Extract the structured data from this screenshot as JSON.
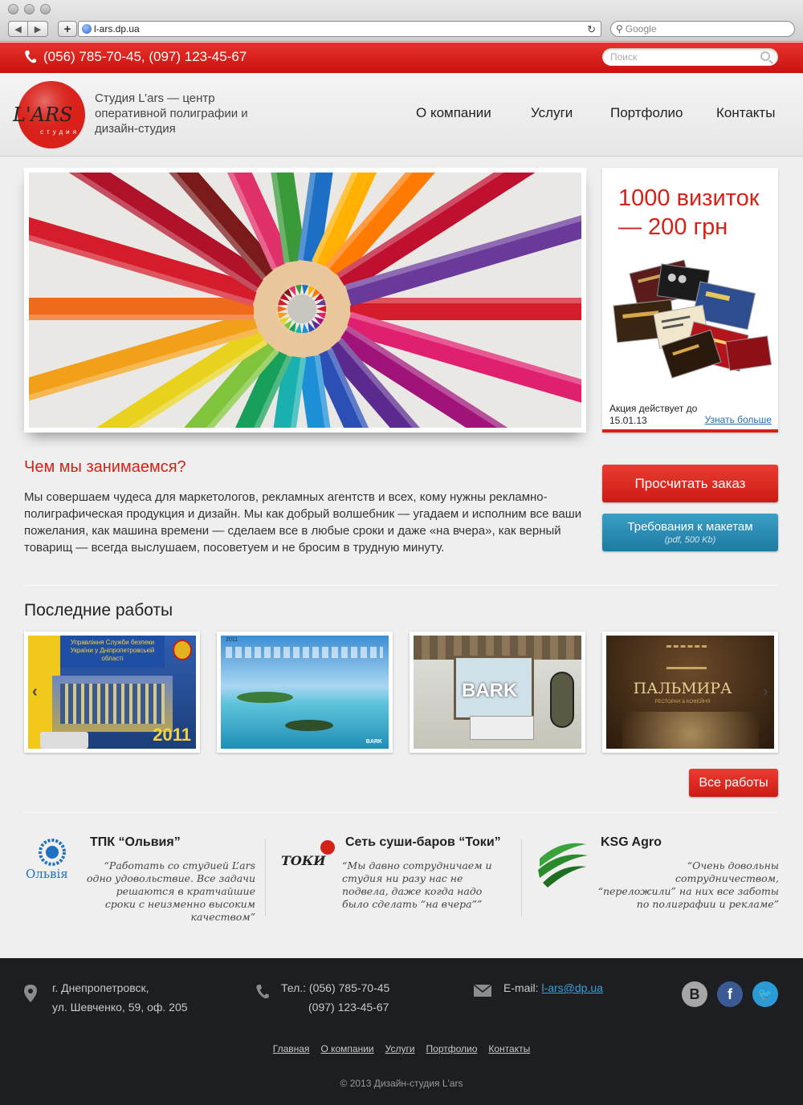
{
  "browser": {
    "url": "l-ars.dp.ua",
    "search_placeholder": "Google"
  },
  "topbar": {
    "phone": "(056) 785-70-45, (097) 123-45-67",
    "search_placeholder": "Поиск"
  },
  "header": {
    "logo_text": "L'ARS",
    "logo_subtext": "студия",
    "tagline": "Студия L’ars — центр оперативной полиграфии и дизайн-студия",
    "nav": [
      "О компании",
      "Услуги",
      "Портфолио",
      "Контакты"
    ]
  },
  "promo": {
    "title": "1000 визиток — 200 грн",
    "until": "Акция действует до 15.01.13",
    "more": "Узнать больше"
  },
  "about": {
    "title": "Чем мы занимаемся?",
    "text": "Мы совершаем чудеса для маркетологов, рекламных агентств и всех, кому нужны рекламно-полиграфическая продукция и дизайн. Мы как добрый волшебник — угадаем и исполним все ваши пожелания, как машина времени — сделаем все в любые сроки и даже «на вчера», как верный товарищ — всегда выслушаем, посоветуем и не бросим в трудную минуту."
  },
  "buttons": {
    "calc": "Просчитать заказ",
    "requirements": "Требования к макетам",
    "requirements_note": "(pdf, 500 Kb)",
    "all_works": "Все работы"
  },
  "works": {
    "title": "Последние работы",
    "prev": "‹",
    "next": "›",
    "items": [
      {
        "caption": "Управління Служби безпеки України у Дніпропетровській області",
        "year": "2011"
      },
      {
        "caption": "2011",
        "brand": "BARK"
      },
      {
        "caption": "BARK"
      },
      {
        "caption": "ПАЛЬМИРА",
        "sub": "РЕСТОРАН & КОФЕЙНЯ"
      }
    ]
  },
  "reviews": [
    {
      "name": "ТПК “Ольвия”",
      "logo_text": "Ольвія",
      "text": "“Работать со студией L’ars одно удовольствие. Все задачи решаются в кратчайшие сроки с неизменно высоким качеством”"
    },
    {
      "name": "Сеть суши-баров “Токи”",
      "logo_text": "ТОКИ",
      "text": "“Мы давно сотрудничаем и студия ни разу нас не подвела, даже когда надо было сделать “на вчера””"
    },
    {
      "name": "KSG Agro",
      "text": "“Очень довольны сотрудничеством, “переложили” на них все заботы по полиграфии и рекламе”"
    }
  ],
  "footer": {
    "city": "г. Днепропетровск,",
    "street": "ул. Шевченко, 59, оф. 205",
    "tel_label": "Тел.: (056) 785-70-45",
    "tel2": "(097) 123-45-67",
    "email_label": "E-mail:",
    "email": "l-ars@dp.ua",
    "nav": [
      "Главная",
      "О компании",
      "Услуги",
      "Портфолио",
      "Контакты"
    ],
    "copyright": "© 2013 Дизайн-студия L'ars"
  },
  "colors": {
    "brand_red": "#d52219",
    "button_blue": "#1d7aa3",
    "footer_bg": "#1d1e22"
  }
}
